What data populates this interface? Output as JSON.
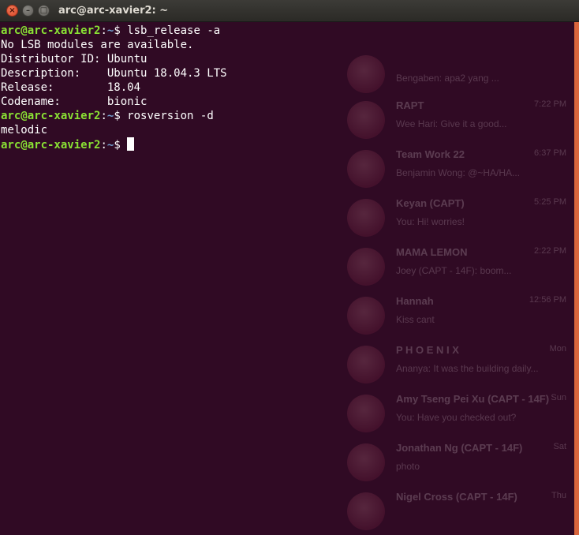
{
  "window": {
    "title": "arc@arc-xavier2: ~",
    "close_glyph": "×",
    "minimize_glyph": "–",
    "maximize_glyph": "□"
  },
  "terminal": {
    "prompt_user": "arc@arc-xavier2",
    "prompt_sep": ":",
    "prompt_path": "~",
    "prompt_symbol": "$ ",
    "cmd1": "lsb_release -a",
    "out1": "No LSB modules are available.",
    "out2": "Distributor ID: Ubuntu",
    "out3": "Description:    Ubuntu 18.04.3 LTS",
    "out4": "Release:        18.04",
    "out5": "Codename:       bionic",
    "cmd2": "rosversion -d",
    "out6": "melodic",
    "cmd3": ""
  },
  "background_chat": [
    {
      "name": "",
      "msg": "Bengaben: apa2 yang ...",
      "time": ""
    },
    {
      "name": "RAPT",
      "msg": "Wee Hari: Give it a good...",
      "time": "7:22 PM"
    },
    {
      "name": "Team Work 22",
      "msg": "Benjamin Wong: @~HA/HA...",
      "time": "6:37 PM"
    },
    {
      "name": "Keyan (CAPT)",
      "msg": "You: Hi! worries!",
      "time": "5:25 PM"
    },
    {
      "name": "MAMA LEMON",
      "msg": "Joey (CAPT - 14F): boom...",
      "time": "2:22 PM"
    },
    {
      "name": "Hannah",
      "msg": "Kiss cant",
      "time": "12:56 PM"
    },
    {
      "name": "P H O E N I X",
      "msg": "Ananya: It was the building daily...",
      "time": "Mon"
    },
    {
      "name": "Amy Tseng Pei Xu (CAPT - 14F)",
      "msg": "You: Have you checked out?",
      "time": "Sun"
    },
    {
      "name": "Jonathan Ng (CAPT - 14F)",
      "msg": "photo",
      "time": "Sat"
    },
    {
      "name": "Nigel Cross (CAPT - 14F)",
      "msg": "",
      "time": "Thu"
    }
  ]
}
